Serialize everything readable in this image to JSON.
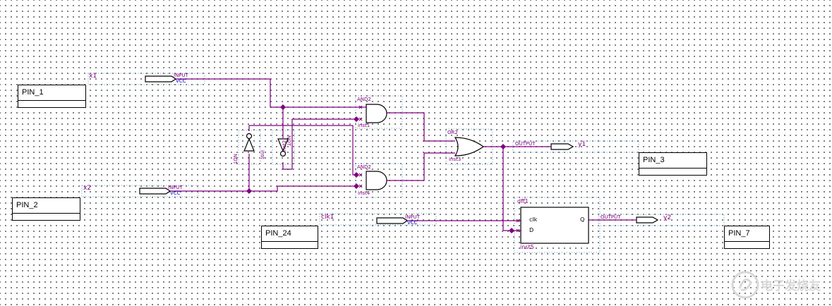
{
  "pins": {
    "pin1": "PIN_1",
    "pin2": "PIN_2",
    "pin24": "PIN_24",
    "pin3": "PIN_3",
    "pin7": "PIN_7"
  },
  "inputs": {
    "x1": {
      "name": "x1",
      "type": "INPUT",
      "default": "VCC"
    },
    "x2": {
      "name": "x2",
      "type": "INPUT",
      "default": "VCC"
    },
    "clk1": {
      "name": "clk1",
      "type": "INPUT",
      "default": "VCC"
    }
  },
  "outputs": {
    "y1": {
      "name": "y1",
      "type": "OUTPUT"
    },
    "y2": {
      "name": "y2",
      "type": "OUTPUT"
    }
  },
  "gates": {
    "and_top": {
      "type": "AND2",
      "inst": "inst1"
    },
    "and_bot": {
      "type": "AND2",
      "inst": "inst4"
    },
    "or": {
      "type": "OR2",
      "inst": "inst3"
    },
    "not_left": {
      "type": "NOT",
      "inst": "inst"
    },
    "not_right": {
      "type": "NOT",
      "inst": "inst2"
    }
  },
  "dff": {
    "type": "dff1",
    "inst": "inst5",
    "clk": "clk",
    "d": "D",
    "q": "Q"
  },
  "watermark": "电子发烧友"
}
